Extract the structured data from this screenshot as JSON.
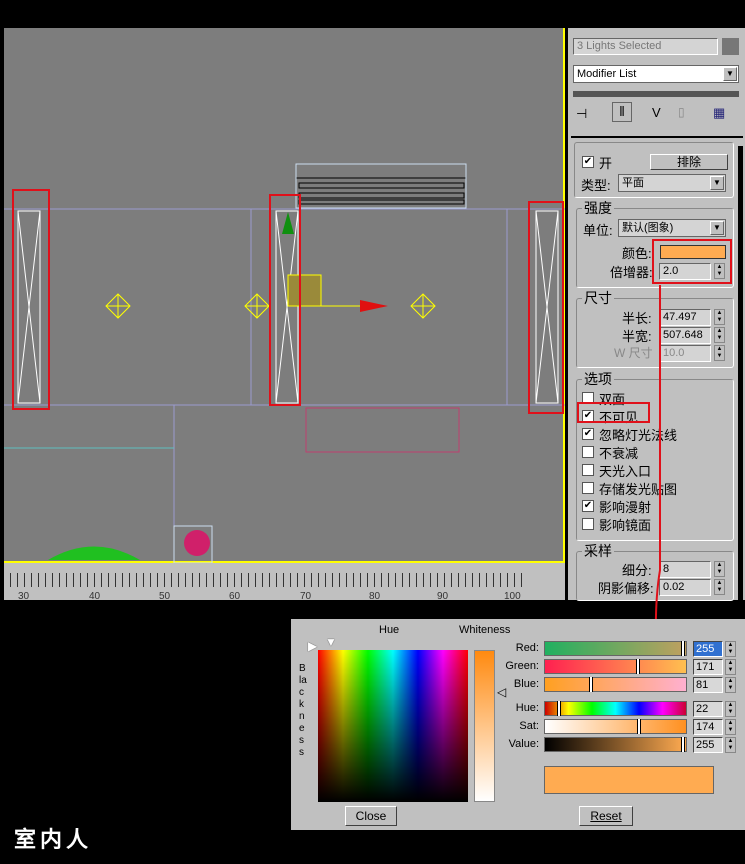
{
  "panel": {
    "selection": "3 Lights Selected",
    "modifier_list": "Modifier List",
    "general": {
      "on_label": "开",
      "on_checked": true,
      "exclude_button": "排除",
      "type_label": "类型:",
      "type_value": "平面"
    },
    "intensity": {
      "title": "强度",
      "unit_label": "单位:",
      "unit_value": "默认(图象)",
      "color_label": "颜色:",
      "color": "#ffab51",
      "multiplier_label": "倍增器:",
      "multiplier": "2.0"
    },
    "size": {
      "title": "尺寸",
      "half_length_label": "半长:",
      "half_length": "47.497",
      "half_width_label": "半宽:",
      "half_width": "507.648",
      "w_size_label": "W 尺寸",
      "w_size": "10.0"
    },
    "options": {
      "title": "选项",
      "items": [
        {
          "label": "双面",
          "checked": false
        },
        {
          "label": "不可见",
          "checked": true
        },
        {
          "label": "忽略灯光法线",
          "checked": true
        },
        {
          "label": "不衰减",
          "checked": false
        },
        {
          "label": "天光入口",
          "checked": false
        },
        {
          "label": "存储发光贴图",
          "checked": false
        },
        {
          "label": "影响漫射",
          "checked": true
        },
        {
          "label": "影响镜面",
          "checked": false
        }
      ]
    },
    "sampling": {
      "title": "采样",
      "subdivs_label": "细分:",
      "subdivs": "8",
      "bias_label": "阴影偏移:",
      "bias": "0.02"
    }
  },
  "ruler": {
    "labels": [
      "30",
      "40",
      "50",
      "60",
      "70",
      "80",
      "90",
      "100"
    ]
  },
  "color_dialog": {
    "hue_label": "Hue",
    "whiteness_label": "Whiteness",
    "blackness_label": "Blackness",
    "channels": [
      {
        "label": "Red:",
        "value": "255",
        "fraction": 1.0
      },
      {
        "label": "Green:",
        "value": "171",
        "fraction": 0.67
      },
      {
        "label": "Blue:",
        "value": "81",
        "fraction": 0.32
      },
      {
        "label": "Hue:",
        "value": "22",
        "fraction": 0.086
      },
      {
        "label": "Sat:",
        "value": "174",
        "fraction": 0.68
      },
      {
        "label": "Value:",
        "value": "255",
        "fraction": 1.0
      }
    ],
    "swatch": "#ffab51",
    "close_button": "Close",
    "reset_button": "Reset"
  },
  "watermark": "室内人"
}
